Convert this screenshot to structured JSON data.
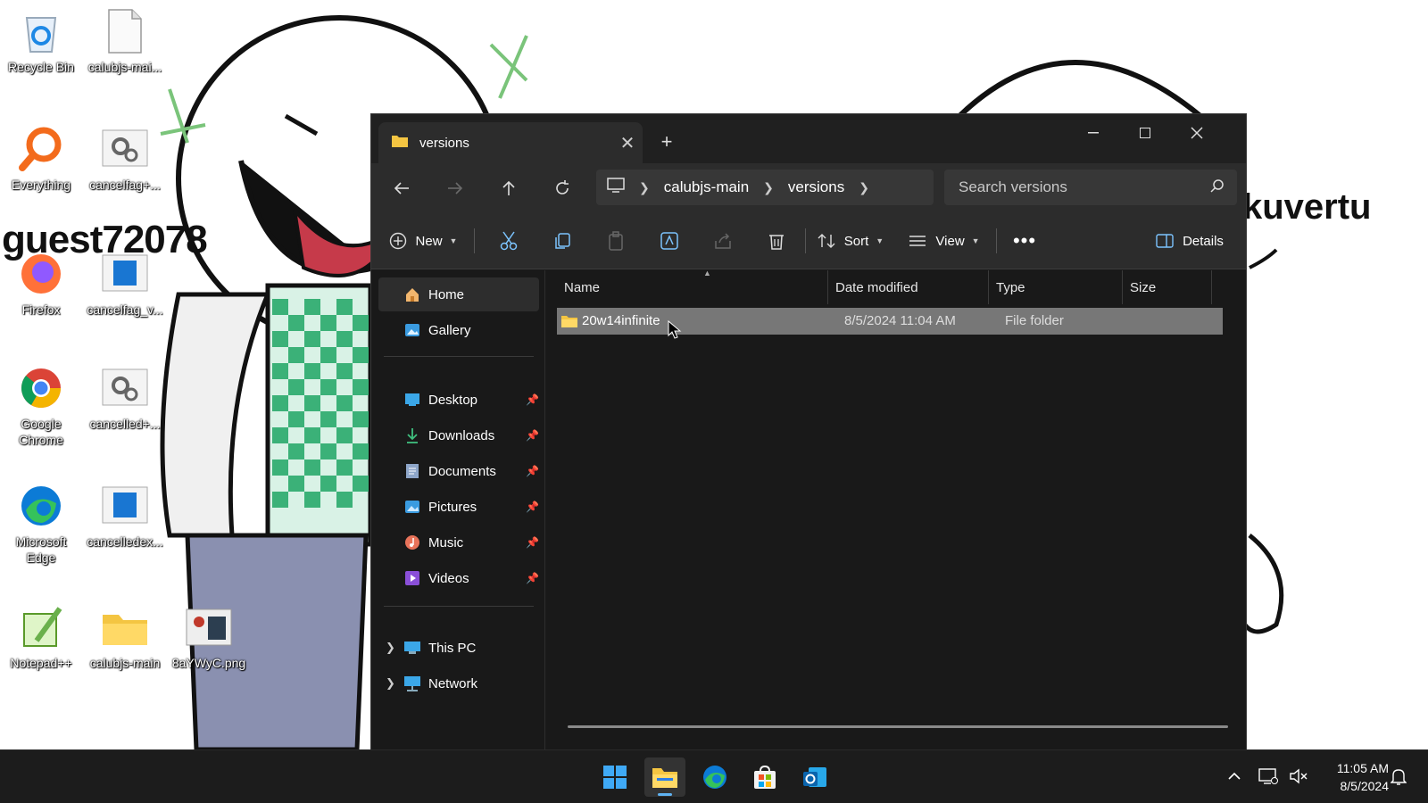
{
  "desktop": {
    "overlay_left": "guest72078",
    "overlay_right": "kuvertu",
    "icons": [
      {
        "label": "Recycle Bin"
      },
      {
        "label": "calubjs-mai..."
      },
      {
        "label": "Everything"
      },
      {
        "label": "cancelfag+..."
      },
      {
        "label": "Firefox"
      },
      {
        "label": "cancelfag_v..."
      },
      {
        "label": "Google Chrome"
      },
      {
        "label": "cancelled+..."
      },
      {
        "label": "Microsoft Edge"
      },
      {
        "label": "cancelledex..."
      },
      {
        "label": "Notepad++"
      },
      {
        "label": "calubjs-main"
      },
      {
        "label": "8aYWyC.png"
      }
    ]
  },
  "explorer": {
    "tab_title": "versions",
    "breadcrumb": [
      "calubjs-main",
      "versions"
    ],
    "search_placeholder": "Search versions",
    "toolbar": {
      "new_label": "New",
      "sort_label": "Sort",
      "view_label": "View",
      "details_label": "Details"
    },
    "sidebar": {
      "home": "Home",
      "gallery": "Gallery",
      "pinned": [
        {
          "label": "Desktop"
        },
        {
          "label": "Downloads"
        },
        {
          "label": "Documents"
        },
        {
          "label": "Pictures"
        },
        {
          "label": "Music"
        },
        {
          "label": "Videos"
        }
      ],
      "this_pc": "This PC",
      "network": "Network"
    },
    "columns": [
      "Name",
      "Date modified",
      "Type",
      "Size"
    ],
    "rows": [
      {
        "name": "20w14infinite",
        "date": "8/5/2024 11:04 AM",
        "type": "File folder",
        "size": ""
      }
    ]
  },
  "taskbar": {
    "time": "11:05 AM",
    "date": "8/5/2024"
  },
  "colors": {
    "selection": "#777777",
    "accent": "#5fb2f2",
    "folder": "#f4c542"
  }
}
